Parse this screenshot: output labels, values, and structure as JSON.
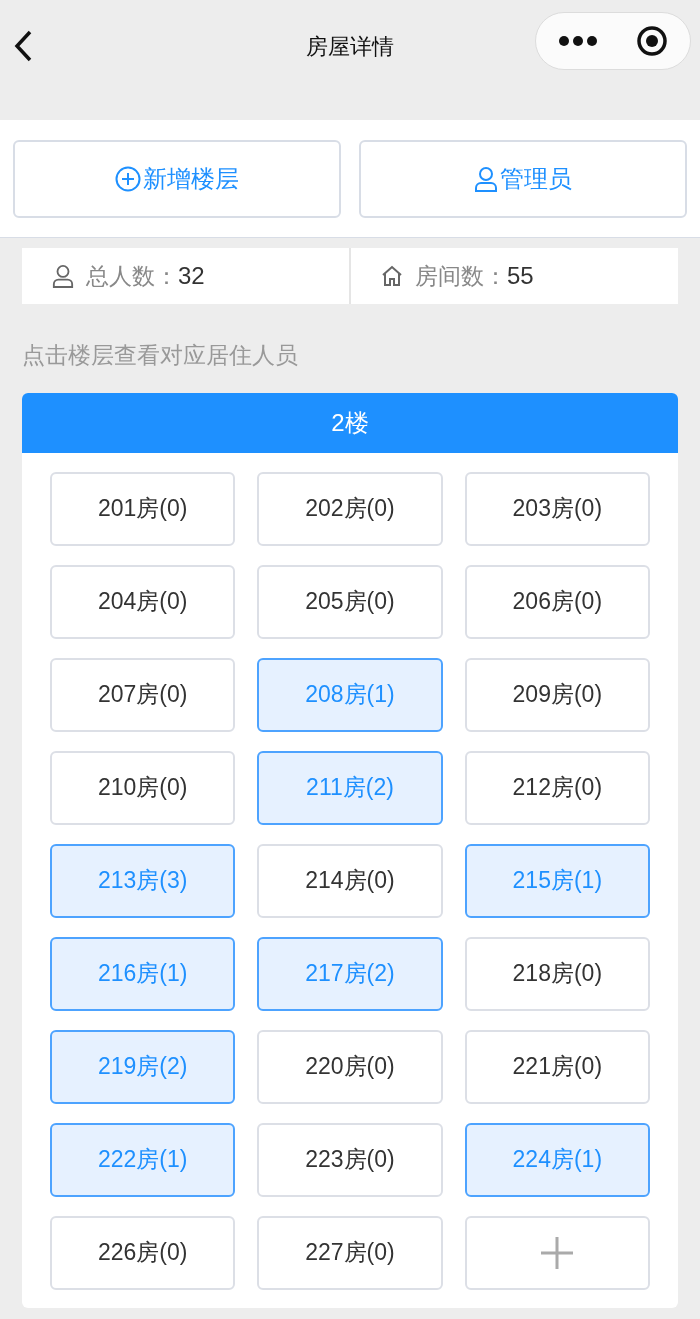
{
  "nav": {
    "title": "房屋详情"
  },
  "actions": [
    {
      "kind": "add",
      "label": "新增楼层"
    },
    {
      "kind": "admin",
      "label": "管理员"
    }
  ],
  "stats": [
    {
      "kind": "people",
      "label": "总人数：",
      "value": "32"
    },
    {
      "kind": "rooms",
      "label": "房间数：",
      "value": "55"
    }
  ],
  "hint": "点击楼层查看对应居住人员",
  "floor": {
    "title": "2楼",
    "rooms": [
      {
        "label": "201房(0)",
        "occupied": false
      },
      {
        "label": "202房(0)",
        "occupied": false
      },
      {
        "label": "203房(0)",
        "occupied": false
      },
      {
        "label": "204房(0)",
        "occupied": false
      },
      {
        "label": "205房(0)",
        "occupied": false
      },
      {
        "label": "206房(0)",
        "occupied": false
      },
      {
        "label": "207房(0)",
        "occupied": false
      },
      {
        "label": "208房(1)",
        "occupied": true
      },
      {
        "label": "209房(0)",
        "occupied": false
      },
      {
        "label": "210房(0)",
        "occupied": false
      },
      {
        "label": "211房(2)",
        "occupied": true
      },
      {
        "label": "212房(0)",
        "occupied": false
      },
      {
        "label": "213房(3)",
        "occupied": true
      },
      {
        "label": "214房(0)",
        "occupied": false
      },
      {
        "label": "215房(1)",
        "occupied": true
      },
      {
        "label": "216房(1)",
        "occupied": true
      },
      {
        "label": "217房(2)",
        "occupied": true
      },
      {
        "label": "218房(0)",
        "occupied": false
      },
      {
        "label": "219房(2)",
        "occupied": true
      },
      {
        "label": "220房(0)",
        "occupied": false
      },
      {
        "label": "221房(0)",
        "occupied": false
      },
      {
        "label": "222房(1)",
        "occupied": true
      },
      {
        "label": "223房(0)",
        "occupied": false
      },
      {
        "label": "224房(1)",
        "occupied": true
      },
      {
        "label": "226房(0)",
        "occupied": false
      },
      {
        "label": "227房(0)",
        "occupied": false
      }
    ]
  }
}
